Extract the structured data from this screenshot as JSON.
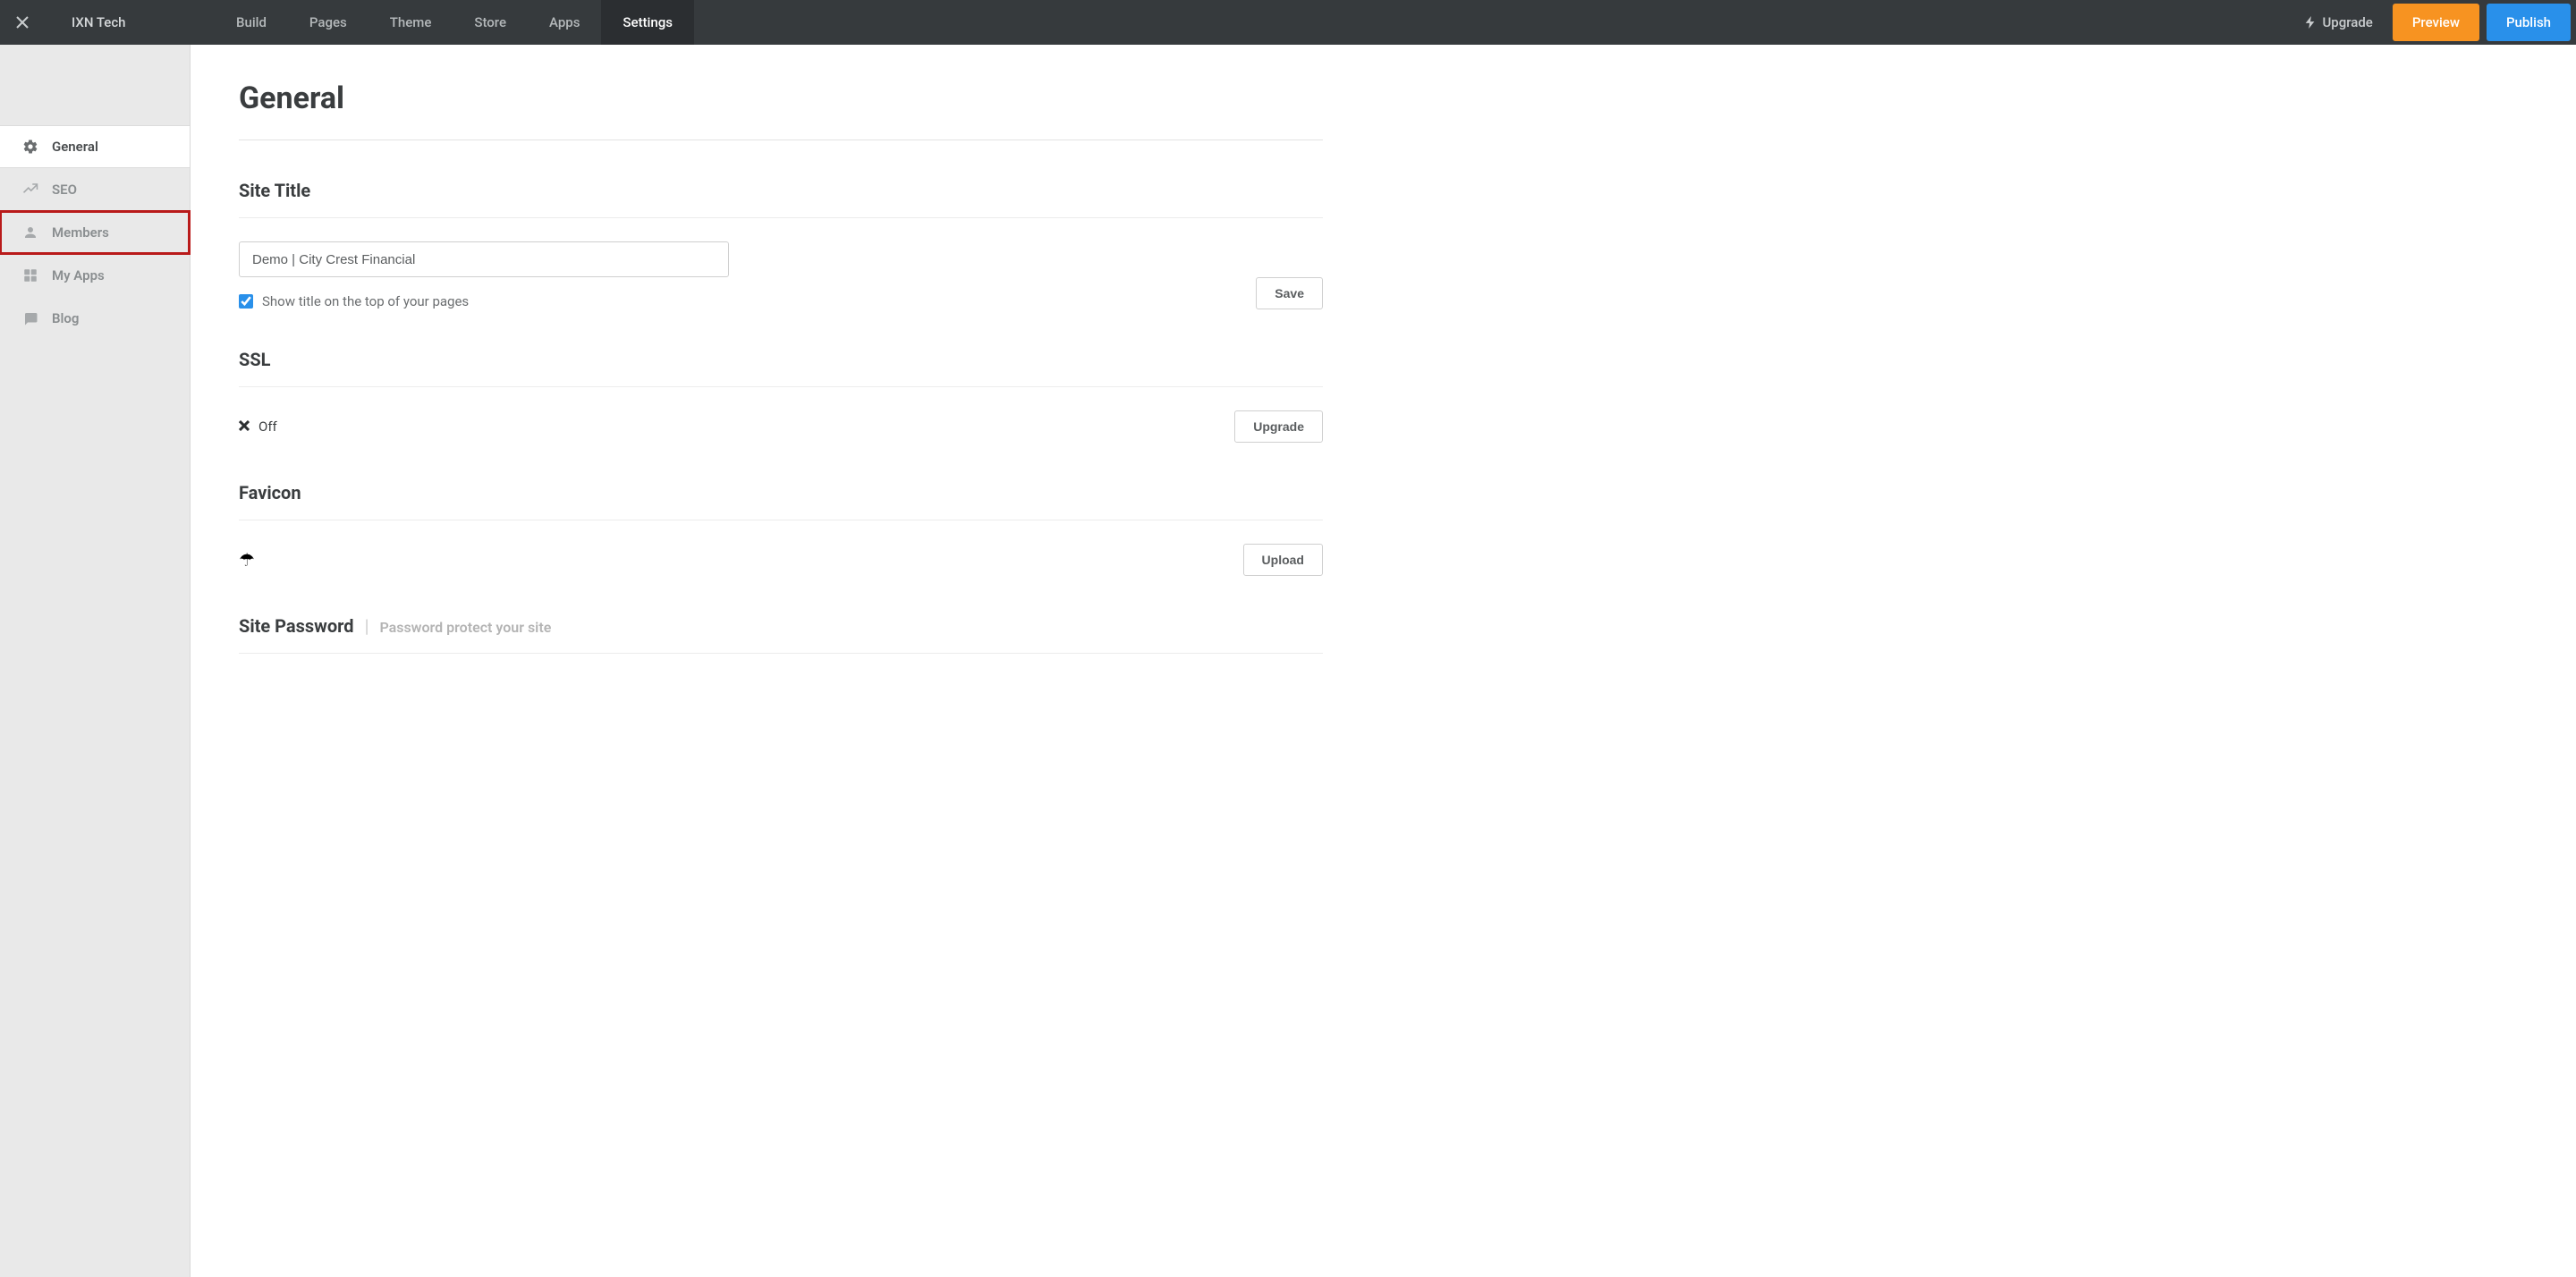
{
  "topbar": {
    "site_name": "IXN Tech",
    "tabs": [
      {
        "label": "Build"
      },
      {
        "label": "Pages"
      },
      {
        "label": "Theme"
      },
      {
        "label": "Store"
      },
      {
        "label": "Apps"
      },
      {
        "label": "Settings",
        "active": true
      }
    ],
    "upgrade_label": "Upgrade",
    "preview_label": "Preview",
    "publish_label": "Publish"
  },
  "sidebar": {
    "items": [
      {
        "label": "General",
        "icon": "gear-icon",
        "active": true
      },
      {
        "label": "SEO",
        "icon": "trend-icon"
      },
      {
        "label": "Members",
        "icon": "person-icon",
        "highlighted": true
      },
      {
        "label": "My Apps",
        "icon": "apps-icon"
      },
      {
        "label": "Blog",
        "icon": "chat-icon"
      }
    ]
  },
  "main": {
    "page_title": "General",
    "site_title": {
      "heading": "Site Title",
      "input_value": "Demo | City Crest Financial",
      "checkbox_label": "Show title on the top of your pages",
      "checkbox_checked": true,
      "save_label": "Save"
    },
    "ssl": {
      "heading": "SSL",
      "status_label": "Off",
      "upgrade_label": "Upgrade"
    },
    "favicon": {
      "heading": "Favicon",
      "upload_label": "Upload"
    },
    "site_password": {
      "heading": "Site Password",
      "sub": "Password protect your site"
    }
  }
}
